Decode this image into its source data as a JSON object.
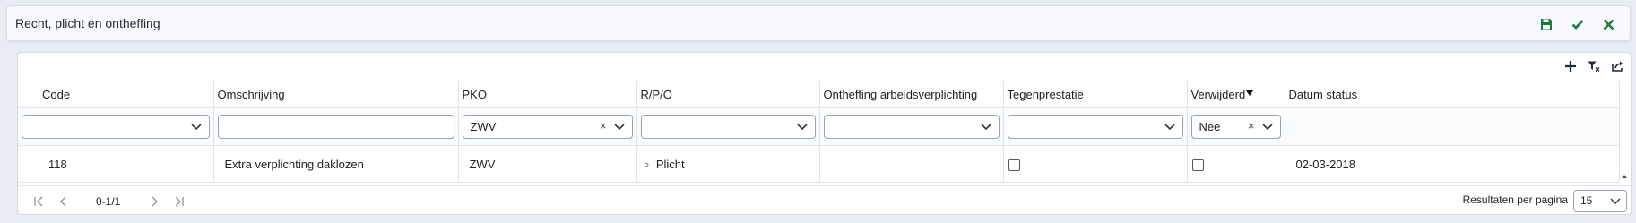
{
  "header": {
    "title": "Recht, plicht en ontheffing",
    "actions": [
      "save-icon",
      "check-icon",
      "close-icon"
    ],
    "colors": {
      "action": "#1c7a3f"
    }
  },
  "toolbar": {
    "icons": [
      "plus-icon",
      "filter-clear-icon",
      "export-icon"
    ]
  },
  "columns": [
    {
      "label": "Code"
    },
    {
      "label": "Omschrijving"
    },
    {
      "label": "PKO"
    },
    {
      "label": "R/P/O"
    },
    {
      "label": "Ontheffing arbeidsverplichting"
    },
    {
      "label": "Tegenprestatie"
    },
    {
      "label": "Verwijderd",
      "sort": "desc"
    },
    {
      "label": "Datum status"
    }
  ],
  "filters": {
    "code": "",
    "omschrijving": "",
    "pko": "ZWV",
    "rpo": "",
    "ontheffing": "",
    "tegenprestatie": "",
    "verwijderd": "Nee",
    "clear_symbol": "×"
  },
  "rows": [
    {
      "code": "118",
      "omschrijving": "Extra verplichting daklozen",
      "pko": "ZWV",
      "rpo_badge": "P",
      "rpo": "Plicht",
      "ontheffing": "",
      "tegenprestatie": false,
      "verwijderd": false,
      "datum_status": "02-03-2018"
    }
  ],
  "pager": {
    "info": "0-1/1",
    "per_page_label": "Resultaten per pagina",
    "per_page_value": "15"
  }
}
